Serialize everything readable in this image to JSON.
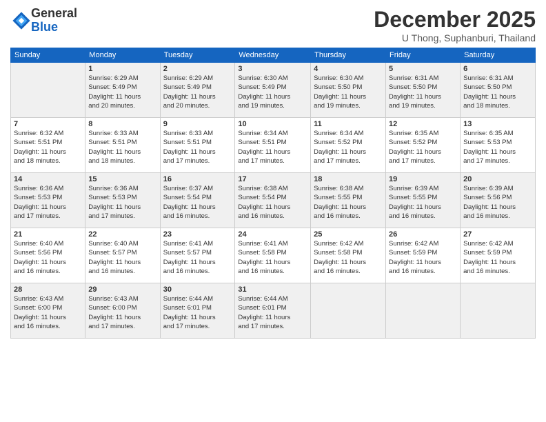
{
  "logo": {
    "general": "General",
    "blue": "Blue"
  },
  "header": {
    "month": "December 2025",
    "location": "U Thong, Suphanburi, Thailand"
  },
  "weekdays": [
    "Sunday",
    "Monday",
    "Tuesday",
    "Wednesday",
    "Thursday",
    "Friday",
    "Saturday"
  ],
  "weeks": [
    [
      {
        "day": "",
        "info": ""
      },
      {
        "day": "1",
        "info": "Sunrise: 6:29 AM\nSunset: 5:49 PM\nDaylight: 11 hours\nand 20 minutes."
      },
      {
        "day": "2",
        "info": "Sunrise: 6:29 AM\nSunset: 5:49 PM\nDaylight: 11 hours\nand 20 minutes."
      },
      {
        "day": "3",
        "info": "Sunrise: 6:30 AM\nSunset: 5:49 PM\nDaylight: 11 hours\nand 19 minutes."
      },
      {
        "day": "4",
        "info": "Sunrise: 6:30 AM\nSunset: 5:50 PM\nDaylight: 11 hours\nand 19 minutes."
      },
      {
        "day": "5",
        "info": "Sunrise: 6:31 AM\nSunset: 5:50 PM\nDaylight: 11 hours\nand 19 minutes."
      },
      {
        "day": "6",
        "info": "Sunrise: 6:31 AM\nSunset: 5:50 PM\nDaylight: 11 hours\nand 18 minutes."
      }
    ],
    [
      {
        "day": "7",
        "info": "Sunrise: 6:32 AM\nSunset: 5:51 PM\nDaylight: 11 hours\nand 18 minutes."
      },
      {
        "day": "8",
        "info": "Sunrise: 6:33 AM\nSunset: 5:51 PM\nDaylight: 11 hours\nand 18 minutes."
      },
      {
        "day": "9",
        "info": "Sunrise: 6:33 AM\nSunset: 5:51 PM\nDaylight: 11 hours\nand 17 minutes."
      },
      {
        "day": "10",
        "info": "Sunrise: 6:34 AM\nSunset: 5:51 PM\nDaylight: 11 hours\nand 17 minutes."
      },
      {
        "day": "11",
        "info": "Sunrise: 6:34 AM\nSunset: 5:52 PM\nDaylight: 11 hours\nand 17 minutes."
      },
      {
        "day": "12",
        "info": "Sunrise: 6:35 AM\nSunset: 5:52 PM\nDaylight: 11 hours\nand 17 minutes."
      },
      {
        "day": "13",
        "info": "Sunrise: 6:35 AM\nSunset: 5:53 PM\nDaylight: 11 hours\nand 17 minutes."
      }
    ],
    [
      {
        "day": "14",
        "info": "Sunrise: 6:36 AM\nSunset: 5:53 PM\nDaylight: 11 hours\nand 17 minutes."
      },
      {
        "day": "15",
        "info": "Sunrise: 6:36 AM\nSunset: 5:53 PM\nDaylight: 11 hours\nand 17 minutes."
      },
      {
        "day": "16",
        "info": "Sunrise: 6:37 AM\nSunset: 5:54 PM\nDaylight: 11 hours\nand 16 minutes."
      },
      {
        "day": "17",
        "info": "Sunrise: 6:38 AM\nSunset: 5:54 PM\nDaylight: 11 hours\nand 16 minutes."
      },
      {
        "day": "18",
        "info": "Sunrise: 6:38 AM\nSunset: 5:55 PM\nDaylight: 11 hours\nand 16 minutes."
      },
      {
        "day": "19",
        "info": "Sunrise: 6:39 AM\nSunset: 5:55 PM\nDaylight: 11 hours\nand 16 minutes."
      },
      {
        "day": "20",
        "info": "Sunrise: 6:39 AM\nSunset: 5:56 PM\nDaylight: 11 hours\nand 16 minutes."
      }
    ],
    [
      {
        "day": "21",
        "info": "Sunrise: 6:40 AM\nSunset: 5:56 PM\nDaylight: 11 hours\nand 16 minutes."
      },
      {
        "day": "22",
        "info": "Sunrise: 6:40 AM\nSunset: 5:57 PM\nDaylight: 11 hours\nand 16 minutes."
      },
      {
        "day": "23",
        "info": "Sunrise: 6:41 AM\nSunset: 5:57 PM\nDaylight: 11 hours\nand 16 minutes."
      },
      {
        "day": "24",
        "info": "Sunrise: 6:41 AM\nSunset: 5:58 PM\nDaylight: 11 hours\nand 16 minutes."
      },
      {
        "day": "25",
        "info": "Sunrise: 6:42 AM\nSunset: 5:58 PM\nDaylight: 11 hours\nand 16 minutes."
      },
      {
        "day": "26",
        "info": "Sunrise: 6:42 AM\nSunset: 5:59 PM\nDaylight: 11 hours\nand 16 minutes."
      },
      {
        "day": "27",
        "info": "Sunrise: 6:42 AM\nSunset: 5:59 PM\nDaylight: 11 hours\nand 16 minutes."
      }
    ],
    [
      {
        "day": "28",
        "info": "Sunrise: 6:43 AM\nSunset: 6:00 PM\nDaylight: 11 hours\nand 16 minutes."
      },
      {
        "day": "29",
        "info": "Sunrise: 6:43 AM\nSunset: 6:00 PM\nDaylight: 11 hours\nand 17 minutes."
      },
      {
        "day": "30",
        "info": "Sunrise: 6:44 AM\nSunset: 6:01 PM\nDaylight: 11 hours\nand 17 minutes."
      },
      {
        "day": "31",
        "info": "Sunrise: 6:44 AM\nSunset: 6:01 PM\nDaylight: 11 hours\nand 17 minutes."
      },
      {
        "day": "",
        "info": ""
      },
      {
        "day": "",
        "info": ""
      },
      {
        "day": "",
        "info": ""
      }
    ]
  ]
}
